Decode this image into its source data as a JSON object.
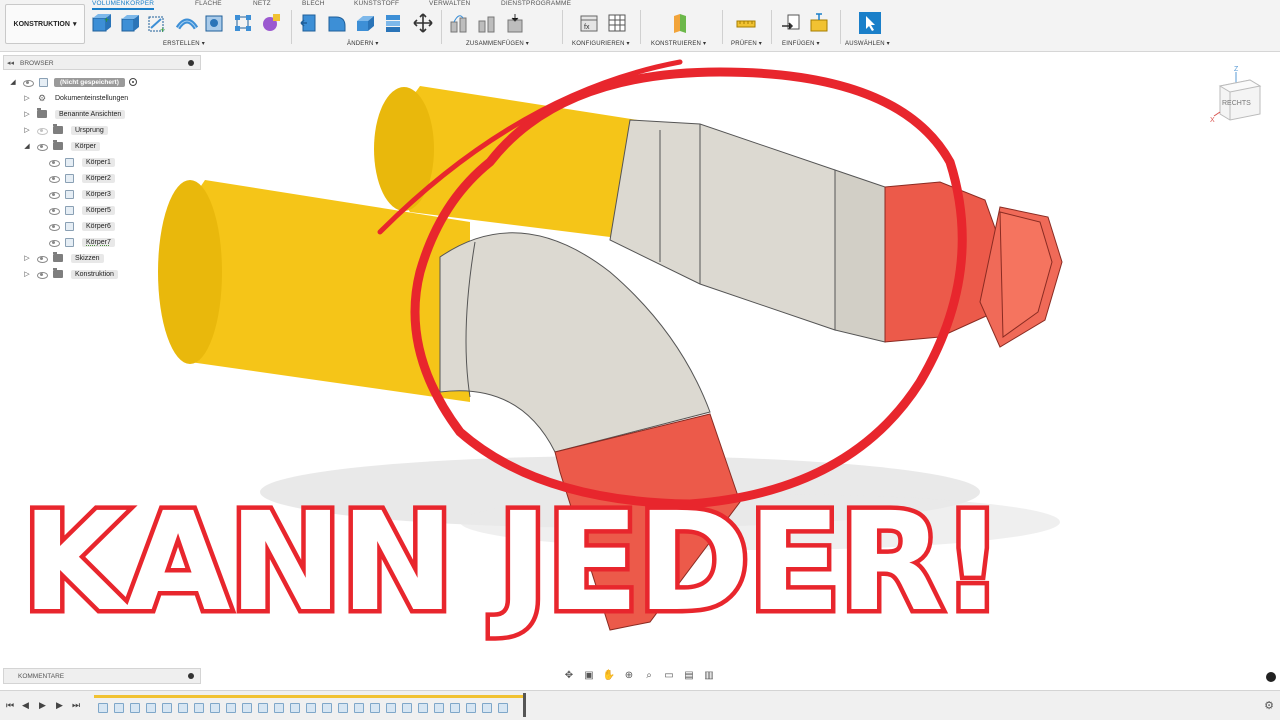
{
  "toolbar": {
    "workspace": "KONSTRUKTION",
    "tabs": [
      "VOLUMENKÖRPER",
      "FLÄCHE",
      "NETZ",
      "BLECH",
      "KUNSTSTOFF",
      "VERWALTEN",
      "DIENSTPROGRAMME"
    ],
    "groups": [
      "ERSTELLEN",
      "ÄNDERN",
      "ZUSAMMENFÜGEN",
      "KONFIGURIEREN",
      "KONSTRUIEREN",
      "PRÜFEN",
      "EINFÜGEN",
      "AUSWÄHLEN"
    ]
  },
  "browser": {
    "title": "BROWSER",
    "root": "(Nicht gespeichert)",
    "items": [
      {
        "label": "Dokumenteinstellungen"
      },
      {
        "label": "Benannte Ansichten"
      },
      {
        "label": "Ursprung"
      },
      {
        "label": "Körper"
      },
      {
        "label": "Körper1"
      },
      {
        "label": "Körper2"
      },
      {
        "label": "Körper3"
      },
      {
        "label": "Körper5"
      },
      {
        "label": "Körper6"
      },
      {
        "label": "Körper7"
      },
      {
        "label": "Skizzen"
      },
      {
        "label": "Konstruktion"
      }
    ]
  },
  "viewcube": {
    "face": "RECHTS",
    "axis_x": "X",
    "axis_z": "Z"
  },
  "overlay": {
    "title": "KANN JEDER!"
  },
  "comments": {
    "title": "KOMMENTARE"
  },
  "colors": {
    "accent": "#1a7fc9",
    "overlay_red": "#e8262d",
    "yellow_body": "#f5c518",
    "grey_body": "#dcd9d1",
    "red_body": "#ec5a4a"
  }
}
